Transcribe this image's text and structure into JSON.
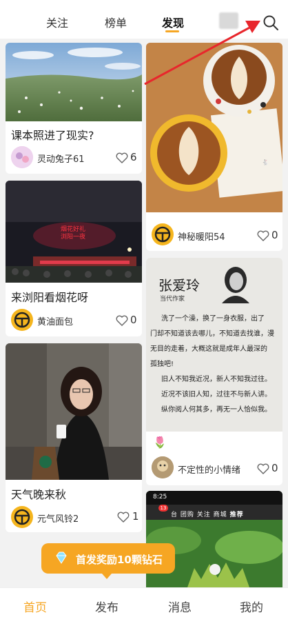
{
  "top_tabs": [
    "关注",
    "榜单",
    "发现"
  ],
  "active_tab": "发现",
  "accent": "#f6a623",
  "cards": [
    {
      "title": "课本照进了现实?",
      "user": "灵动兔子61",
      "likes": "6"
    },
    {
      "title": "",
      "user": "神秘暖阳54",
      "likes": "0"
    },
    {
      "title": "来浏阳看烟花呀",
      "user": "黄油面包",
      "likes": "0",
      "overlay": "烟花好礼\n浏阳一夜"
    },
    {
      "title": "",
      "user": "不定性的小情绪",
      "likes": "0"
    },
    {
      "title": "天气晚来秋",
      "user": "元气风铃2",
      "likes": "1"
    }
  ],
  "book": {
    "name": "张爱玲",
    "role": "当代作家",
    "lines": [
      "洗了一个澡，换了一身衣服，出了",
      "门却不知道该去哪儿，不知道去找谁，漫",
      "无目的走着，大概这就是成年人最深的",
      "孤独吧!",
      "旧人不知我近况，新人不知我过往。",
      "近况不该旧人知，过往不与新人讲。",
      "纵你阅人何其多，再无一人恰似我。"
    ]
  },
  "phone_thumb": {
    "time": "8:25",
    "badge": "13",
    "tabs": [
      "台",
      "团购",
      "关注",
      "商城",
      "推荐"
    ]
  },
  "promo_text": "首发奖励10颗钻石",
  "bottom_nav": [
    "首页",
    "发布",
    "消息",
    "我的"
  ],
  "active_nav": "首页"
}
